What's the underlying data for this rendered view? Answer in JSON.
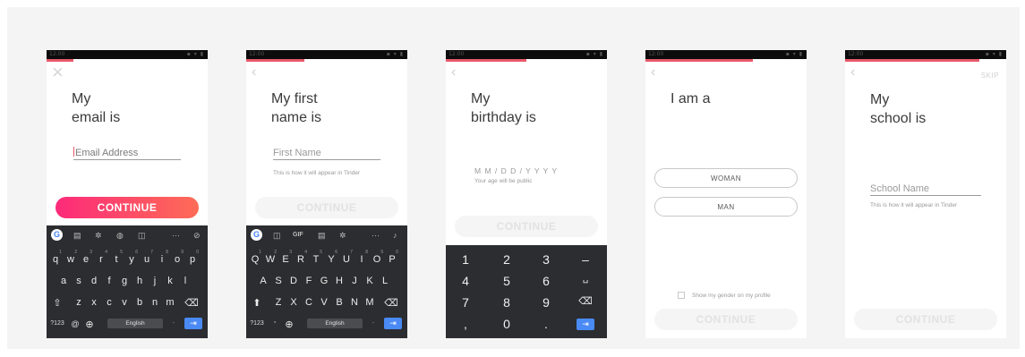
{
  "colors": {
    "accent": "#e85a6a",
    "cta_start": "#fd2a7a",
    "cta_end": "#fd6c56",
    "keyboard_bg": "#2b2d30",
    "enter_key": "#4a8af4"
  },
  "screens": [
    {
      "title": "My\nemail is",
      "input_placeholder": "Email Address",
      "cta": "CONTINUE",
      "keyboard": {
        "toolbar": [
          "google-icon",
          "clipboard-icon",
          "gear-icon",
          "palette-icon",
          "sticker-icon",
          "more-icon",
          "mic-off-icon"
        ],
        "row1": [
          "q",
          "w",
          "e",
          "r",
          "t",
          "y",
          "u",
          "i",
          "o",
          "p"
        ],
        "row1_hints": [
          "1",
          "2",
          "3",
          "4",
          "5",
          "6",
          "7",
          "8",
          "9",
          "0"
        ],
        "row2": [
          "a",
          "s",
          "d",
          "f",
          "g",
          "h",
          "j",
          "k",
          "l"
        ],
        "row3": [
          "z",
          "x",
          "c",
          "v",
          "b",
          "n",
          "m"
        ],
        "bottom": {
          "sym": "?123",
          "at": "@",
          "space": "English",
          "period": "."
        }
      }
    },
    {
      "title": "My first\nname is",
      "input_placeholder": "First Name",
      "helper": "This is how it will appear in Tinder",
      "cta": "CONTINUE",
      "keyboard": {
        "toolbar": [
          "google-icon",
          "sticker-icon",
          "gif-icon",
          "clipboard-icon",
          "gear-icon",
          "more-icon",
          "mic-icon"
        ],
        "gif_label": "GIF",
        "row1": [
          "Q",
          "W",
          "E",
          "R",
          "T",
          "Y",
          "U",
          "I",
          "O",
          "P"
        ],
        "row1_hints": [
          "1",
          "2",
          "3",
          "4",
          "5",
          "6",
          "7",
          "8",
          "9",
          "0"
        ],
        "row2": [
          "A",
          "S",
          "D",
          "F",
          "G",
          "H",
          "J",
          "K",
          "L"
        ],
        "row3": [
          "Z",
          "X",
          "C",
          "V",
          "B",
          "N",
          "M"
        ],
        "bottom": {
          "sym": "?123",
          "comma": ",",
          "space": "English",
          "period": "."
        }
      }
    },
    {
      "title": "My\nbirthday is",
      "date_placeholder": "M M / D D / Y Y Y Y",
      "helper": "Your age will be public",
      "cta": "CONTINUE",
      "numpad": [
        [
          "1",
          "2",
          "3",
          "–"
        ],
        [
          "4",
          "5",
          "6",
          "␣"
        ],
        [
          "7",
          "8",
          "9",
          "⌫"
        ],
        [
          ",",
          "0",
          ".",
          "⇥"
        ]
      ]
    },
    {
      "title": "I am a",
      "options": [
        "WOMAN",
        "MAN"
      ],
      "checkbox_label": "Show my gender on my profile",
      "cta": "CONTINUE"
    },
    {
      "title": "My\nschool is",
      "skip": "SKIP",
      "input_placeholder": "School Name",
      "helper": "This is how it will appear in Tinder",
      "cta": "CONTINUE"
    }
  ]
}
